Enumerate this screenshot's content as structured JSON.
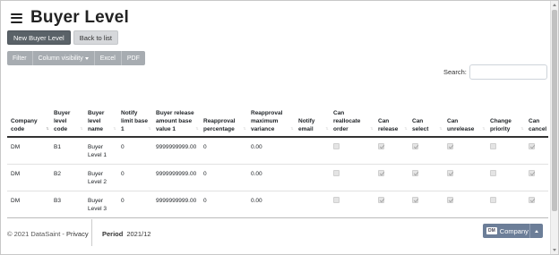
{
  "page": {
    "title": "Buyer Level"
  },
  "actions": {
    "new_label": "New Buyer Level",
    "back_label": "Back to list"
  },
  "toolbar": {
    "filter": "Filter",
    "column_visibility": "Column visibility",
    "excel": "Excel",
    "pdf": "PDF"
  },
  "search": {
    "label": "Search:",
    "value": ""
  },
  "table": {
    "columns": [
      "Company code",
      "Buyer level code",
      "Buyer level name",
      "Notify limit base 1",
      "Buyer release amount base value 1",
      "Reapproval percentage",
      "Reapproval maximum variance",
      "Notify email",
      "Can reallocate order",
      "Can release",
      "Can select",
      "Can unrelease",
      "Change priority",
      "Can cancel"
    ],
    "sorted_column": "Company code",
    "rows": [
      {
        "company_code": "DM",
        "level_code": "B1",
        "level_name": "Buyer Level 1",
        "notify_limit": "0",
        "release_amount": "9999999999.00",
        "reapproval_pct": "0",
        "reapproval_max": "0.00",
        "notify_email": "",
        "can_reallocate": false,
        "can_release": true,
        "can_select": true,
        "can_unrelease": true,
        "change_priority": false,
        "can_cancel": true
      },
      {
        "company_code": "DM",
        "level_code": "B2",
        "level_name": "Buyer Level 2",
        "notify_limit": "0",
        "release_amount": "9999999999.00",
        "reapproval_pct": "0",
        "reapproval_max": "0.00",
        "notify_email": "",
        "can_reallocate": false,
        "can_release": true,
        "can_select": true,
        "can_unrelease": true,
        "change_priority": false,
        "can_cancel": true
      },
      {
        "company_code": "DM",
        "level_code": "B3",
        "level_name": "Buyer Level 3",
        "notify_limit": "0",
        "release_amount": "9999999999.00",
        "reapproval_pct": "0",
        "reapproval_max": "0.00",
        "notify_email": "",
        "can_reallocate": false,
        "can_release": true,
        "can_select": true,
        "can_unrelease": true,
        "change_priority": false,
        "can_cancel": true
      }
    ]
  },
  "footer": {
    "copyright": "© 2021 DataSaint - ",
    "privacy_label": "Privacy",
    "period_label": "Period",
    "period_value": "2021/12",
    "company_badge": "DM",
    "company_label": "Company"
  },
  "colors": {
    "primary_button": "#5a6268",
    "toolbar_button": "#a7acb1",
    "company_button": "#6c7e98"
  }
}
